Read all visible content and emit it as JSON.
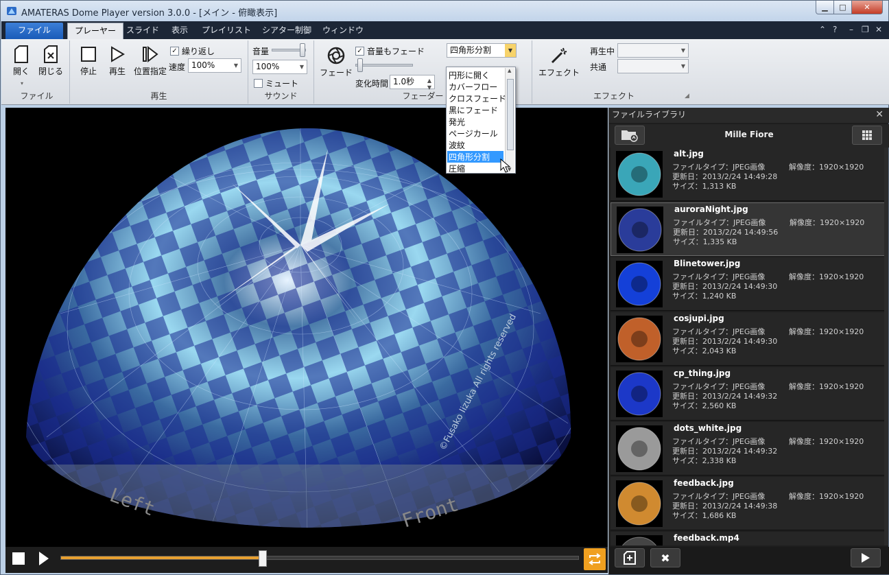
{
  "window": {
    "title": "AMATERAS Dome Player version 3.0.0 - [メイン - 俯瞰表示]"
  },
  "tabs": [
    {
      "label": "ファイル"
    },
    {
      "label": "プレーヤー"
    },
    {
      "label": "スライド"
    },
    {
      "label": "表示"
    },
    {
      "label": "プレイリスト"
    },
    {
      "label": "シアター制御"
    },
    {
      "label": "ウィンドウ"
    }
  ],
  "ribbon": {
    "file_group": {
      "label": "ファイル",
      "open": "開く",
      "close": "閉じる"
    },
    "play_group": {
      "label": "再生",
      "stop": "停止",
      "play": "再生",
      "seek": "位置指定",
      "repeat": "繰り返し",
      "speed_label": "速度",
      "speed_value": "100%"
    },
    "sound_group": {
      "label": "サウンド",
      "volume_label": "音量",
      "volume_value": "100%",
      "mute": "ミュート"
    },
    "fader_group": {
      "label": "フェーダー",
      "fade": "フェード",
      "fade_volume": "音量もフェード",
      "time_label": "変化時間",
      "time_value": "1.0秒",
      "transition_value": "四角形分割"
    },
    "effect_group": {
      "label": "エフェクト",
      "effect": "エフェクト",
      "playing_label": "再生中",
      "common_label": "共通"
    }
  },
  "dropdown": {
    "items": [
      "円形に開く",
      "カバーフロー",
      "クロスフェード",
      "黒にフェード",
      "発光",
      "ページカール",
      "波紋",
      "四角形分割",
      "圧縮"
    ],
    "selected_index": 7
  },
  "viewport": {
    "label_left": "Left",
    "label_front": "Front",
    "credit": "©Fusako Iizuka All rights reserved"
  },
  "transport": {
    "progress": 0.39
  },
  "library": {
    "title": "ファイルライブラリ",
    "folder": "Mille Fiore",
    "type_label": "ファイルタイプ：",
    "date_label": "更新日：",
    "size_label": "サイズ：",
    "res_label": "解像度：",
    "files": [
      {
        "name": "alt.jpg",
        "type": "JPEG画像",
        "date": "2013/2/24 14:49:28",
        "size": "1,313 KB",
        "res": "1920×1920",
        "color": "#3aa6b8"
      },
      {
        "name": "auroraNight.jpg",
        "type": "JPEG画像",
        "date": "2013/2/24 14:49:56",
        "size": "1,335 KB",
        "res": "1920×1920",
        "color": "#2a3c9a"
      },
      {
        "name": "Blinetower.jpg",
        "type": "JPEG画像",
        "date": "2013/2/24 14:49:30",
        "size": "1,240 KB",
        "res": "1920×1920",
        "color": "#1440d8"
      },
      {
        "name": "cosjupi.jpg",
        "type": "JPEG画像",
        "date": "2013/2/24 14:49:30",
        "size": "2,043 KB",
        "res": "1920×1920",
        "color": "#c0602a"
      },
      {
        "name": "cp_thing.jpg",
        "type": "JPEG画像",
        "date": "2013/2/24 14:49:32",
        "size": "2,560 KB",
        "res": "1920×1920",
        "color": "#1c38c8"
      },
      {
        "name": "dots_white.jpg",
        "type": "JPEG画像",
        "date": "2013/2/24 14:49:32",
        "size": "2,338 KB",
        "res": "1920×1920",
        "color": "#9a9a9a"
      },
      {
        "name": "feedback.jpg",
        "type": "JPEG画像",
        "date": "2013/2/24 14:49:38",
        "size": "1,686 KB",
        "res": "1920×1920",
        "color": "#d08a30"
      },
      {
        "name": "feedback.mp4",
        "type": "",
        "date": "",
        "size": "",
        "res": "",
        "color": "#444"
      }
    ],
    "selected_index": 1
  }
}
